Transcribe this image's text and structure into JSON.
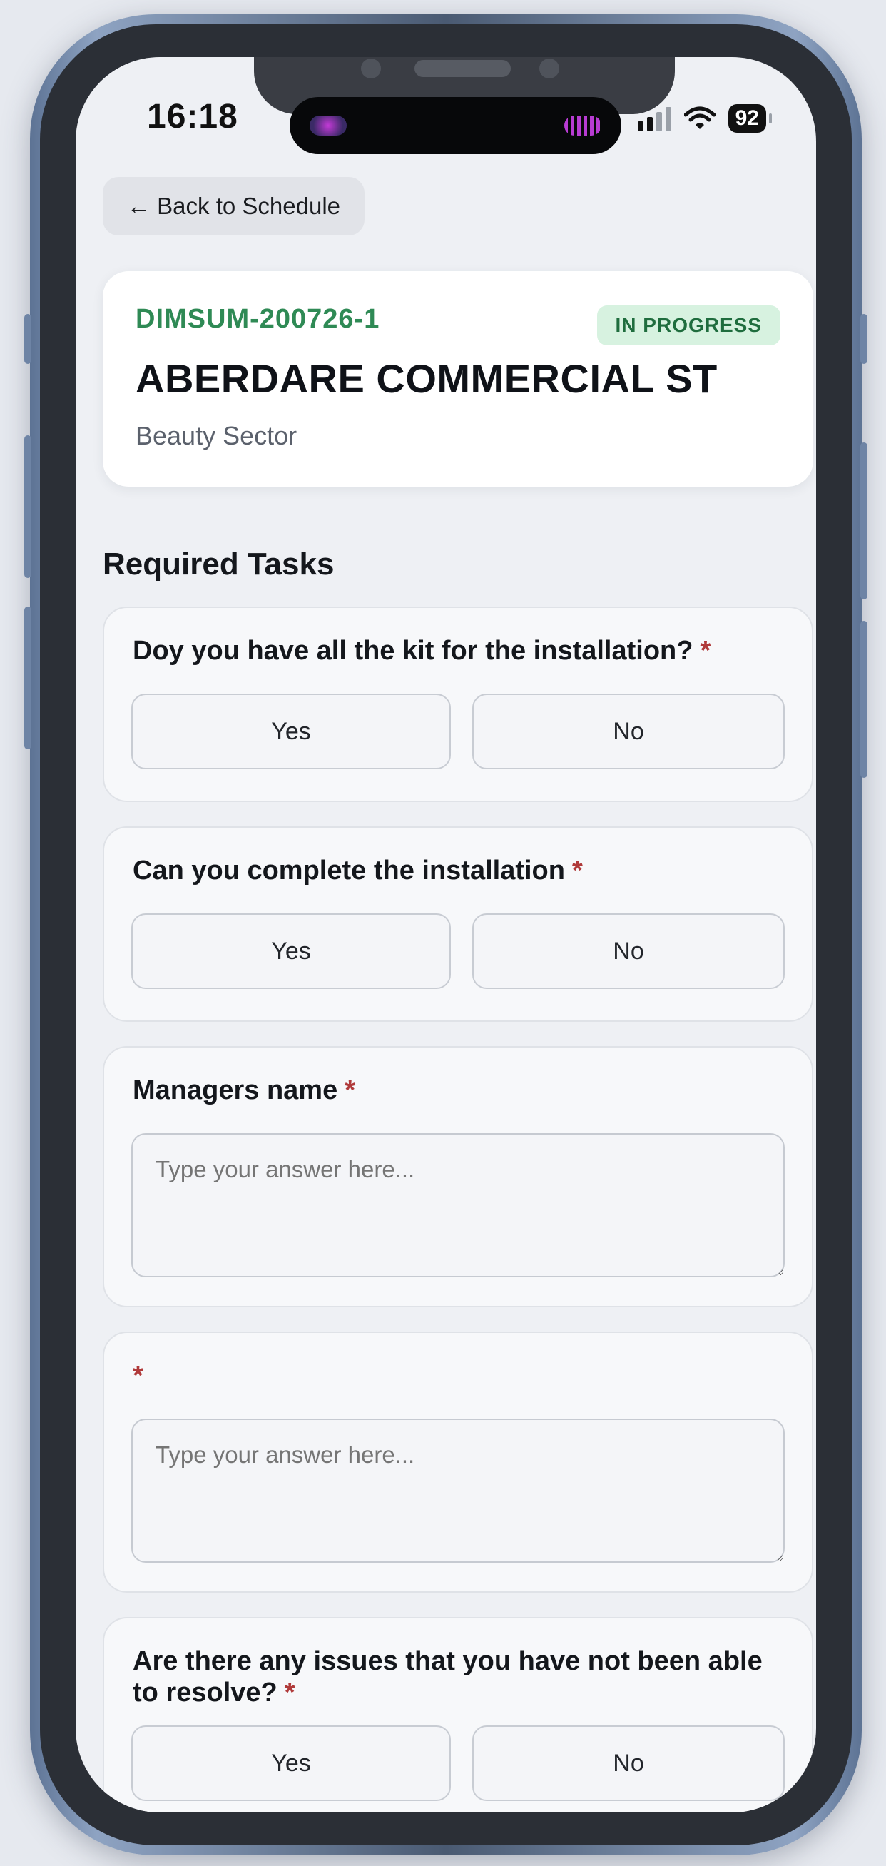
{
  "status_bar": {
    "time": "16:18",
    "battery": "92"
  },
  "nav": {
    "back_label": "← Back to Schedule"
  },
  "job": {
    "id": "DIMSUM-200726-1",
    "status": "IN PROGRESS",
    "site_name": "ABERDARE COMMERCIAL ST",
    "sector": "Beauty Sector"
  },
  "section_title": "Required Tasks",
  "tasks": [
    {
      "question": "Doy you have all the kit for the installation?",
      "required_mark": "*",
      "yes": "Yes",
      "no": "No"
    },
    {
      "question": "Can you complete the installation",
      "required_mark": "*",
      "yes": "Yes",
      "no": "No"
    },
    {
      "question": "Managers name",
      "required_mark": "*",
      "placeholder": "Type your answer here..."
    },
    {
      "question": "",
      "required_mark": "*",
      "placeholder": "Type your answer here..."
    },
    {
      "question": "Are there any issues that you have not been able to resolve?",
      "required_mark": "*",
      "yes": "Yes",
      "no": "No"
    }
  ],
  "colors": {
    "job_id": "#2f8a55",
    "badge_bg": "#d7f2e0",
    "badge_text": "#1f6d3e",
    "required": "#b03a3a",
    "screen_bg": "#eef0f4"
  }
}
